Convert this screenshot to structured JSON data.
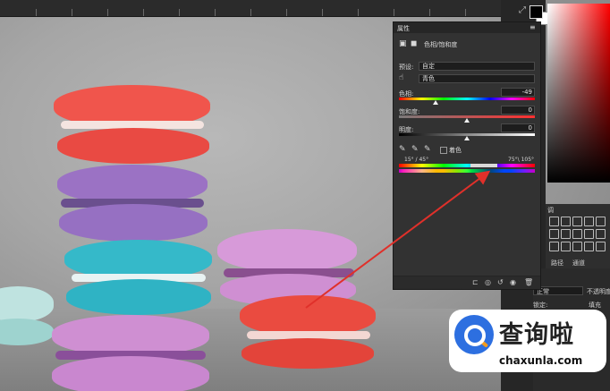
{
  "properties_panel": {
    "tab_title": "属性",
    "panel_type": "色相/饱和度",
    "preset_label": "预设:",
    "preset_value": "自定",
    "channel_value": "青色",
    "hue_label": "色相:",
    "hue_value": "-49",
    "saturation_label": "饱和度:",
    "saturation_value": "0",
    "lightness_label": "明度:",
    "lightness_value": "0",
    "colorize_label": "着色",
    "range_left": "15° / 45°",
    "range_right": "75°\\ 105°"
  },
  "layers_panel": {
    "tab_paths": "路径",
    "tab_channels": "通道",
    "blend_mode": "正常",
    "opacity_label": "不透明度",
    "lock_label": "锁定:",
    "fill_label": "填充",
    "adjust_title": "调"
  },
  "watermark": {
    "chinese": "查询啦",
    "domain": "chaxunla.com"
  },
  "colors": {
    "panel_bg": "#323232",
    "annotation_arrow": "#e0302a",
    "watermark_blue": "#2d6fe0"
  },
  "icons": [
    "adjustment-layer-icon",
    "mask-icon",
    "hand-tool-icon",
    "eyedropper-icon",
    "eyedropper-plus-icon",
    "eyedropper-minus-icon",
    "clip-icon",
    "visibility-icon",
    "reset-icon",
    "eye-icon",
    "trash-icon",
    "menu-icon",
    "close-icon"
  ]
}
